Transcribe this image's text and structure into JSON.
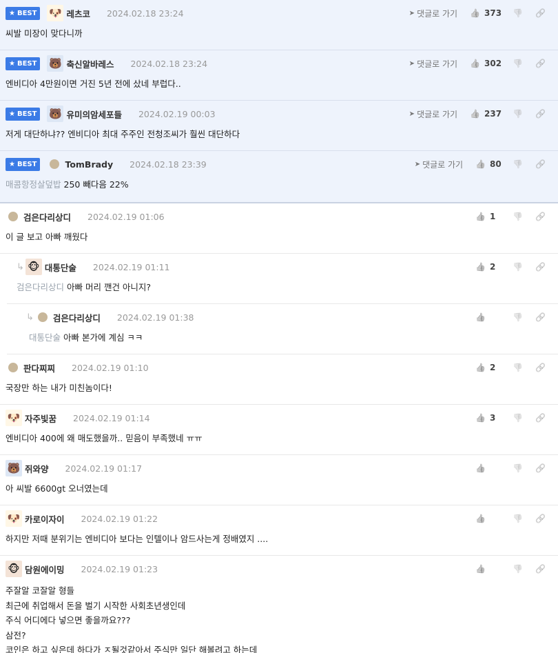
{
  "labels": {
    "best": "BEST",
    "goto": "댓글로 가기"
  },
  "comments": [
    {
      "type": "best",
      "avatar": "dog",
      "nick": "레츠코",
      "date": "2024.02.18 23:24",
      "likes": "373",
      "text": "씨발 미장이 맞다니까"
    },
    {
      "type": "best",
      "avatar": "bear",
      "nick": "축신알바레스",
      "date": "2024.02.18 23:24",
      "likes": "302",
      "text": "엔비디아 4만원이면 거진 5년 전에 샀네 부럽다.."
    },
    {
      "type": "best",
      "avatar": "bear",
      "nick": "유미의암세포들",
      "date": "2024.02.19 00:03",
      "likes": "237",
      "text": "저게 대단하냐?? 엔비디아 최대 주주인 전청조씨가 훨씬 대단하다"
    },
    {
      "type": "best",
      "avatar": "dot",
      "nick": "TomBrady",
      "date": "2024.02.18 23:39",
      "likes": "80",
      "mention": "매콤항정살덮밥",
      "text": "250 빼다음 22%"
    },
    {
      "type": "normal",
      "avatar": "dot",
      "nick": "검은다리상디",
      "date": "2024.02.19 01:06",
      "likes": "1",
      "text": "이 글 보고 아빠 깨웠다"
    },
    {
      "type": "reply1",
      "avatar": "face",
      "nick": "대통단술",
      "date": "2024.02.19 01:11",
      "likes": "2",
      "mention": "검은다리상디",
      "text": "아빠 머리 깬건 아니지?"
    },
    {
      "type": "reply2",
      "avatar": "dot",
      "nick": "검은다리상디",
      "date": "2024.02.19 01:38",
      "likes": "",
      "mention": "대통단술",
      "text": "아빠 본가에 계심 ㅋㅋ"
    },
    {
      "type": "normal",
      "avatar": "dot",
      "nick": "판다찌찌",
      "date": "2024.02.19 01:10",
      "likes": "2",
      "text": "국장만 하는 내가 미친놈이다!"
    },
    {
      "type": "normal",
      "avatar": "dog",
      "nick": "자주빛꿈",
      "date": "2024.02.19 01:14",
      "likes": "3",
      "text": "엔비디아 400에 왜 매도했을까.. 믿음이 부족했네 ㅠㅠ"
    },
    {
      "type": "normal",
      "avatar": "bear",
      "nick": "쥐와양",
      "date": "2024.02.19 01:17",
      "likes": "",
      "text": "아 씨발 6600gt 오너였는데"
    },
    {
      "type": "normal",
      "avatar": "dog",
      "nick": "카로이자이",
      "date": "2024.02.19 01:22",
      "likes": "",
      "text": "하지만 저때 분위기는 엔비디아 보다는 인텔이나 암드사는게 정배였지 ...."
    },
    {
      "type": "multi",
      "avatar": "face",
      "nick": "담원에이밍",
      "date": "2024.02.19 01:23",
      "likes": "",
      "lines": [
        "주잘알 코잘알 형들",
        "최근에 취업해서 돈을 벌기 시작한 사회초년생인데",
        "주식 어디에다 넣으면 좋을까요???",
        "삼전?",
        "코인은 하고 싶은데 하다가 ㅈ될것같아서 주식만 일단 해볼려고 하는데"
      ]
    }
  ]
}
